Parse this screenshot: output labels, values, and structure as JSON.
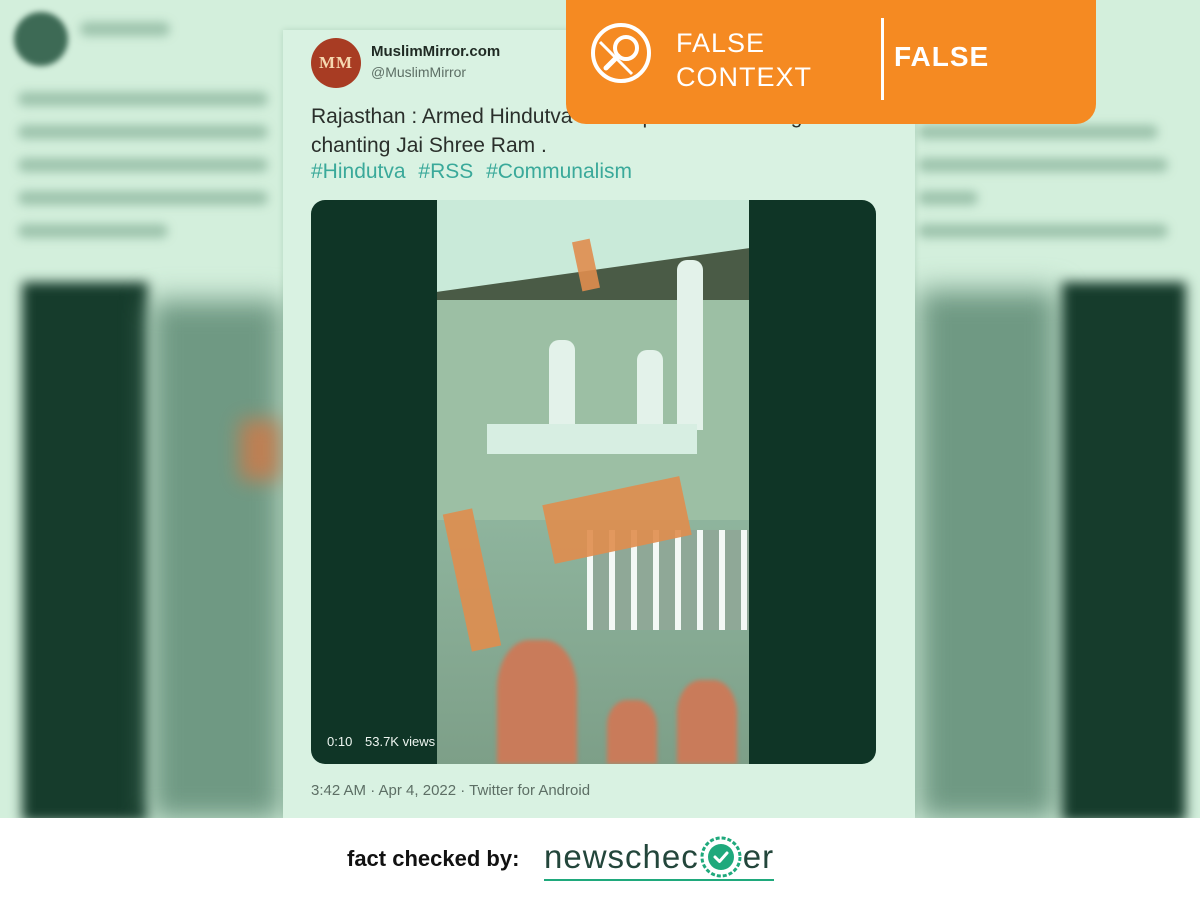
{
  "tweet": {
    "author_name": "MuslimMirror.com",
    "author_handle": "@MuslimMirror",
    "avatar_text": "MM",
    "text": "Rajasthan : Armed Hindutva a mosque with RSS flags and chanting Jai Shree Ram .",
    "hashtags": [
      "#Hindutva",
      "#RSS",
      "#Communalism"
    ],
    "video_time": "0:10",
    "video_views": "53.7K views",
    "meta": "3:42 AM · Apr 4, 2022 · Twitter for Android"
  },
  "badge": {
    "label": "FALSE CONTEXT",
    "verdict": "FALSE",
    "color": "#f58a22",
    "icon": "magnifier-icon"
  },
  "footer": {
    "label": "fact checked by:",
    "brand_pre": "newschec",
    "brand_post": "er",
    "brand_icon": "checkmark-circle-icon"
  },
  "colors": {
    "hashtag": "#3aa99a",
    "overlay_tint": "#d9f2e2",
    "brand_accent": "#1fa97c"
  }
}
